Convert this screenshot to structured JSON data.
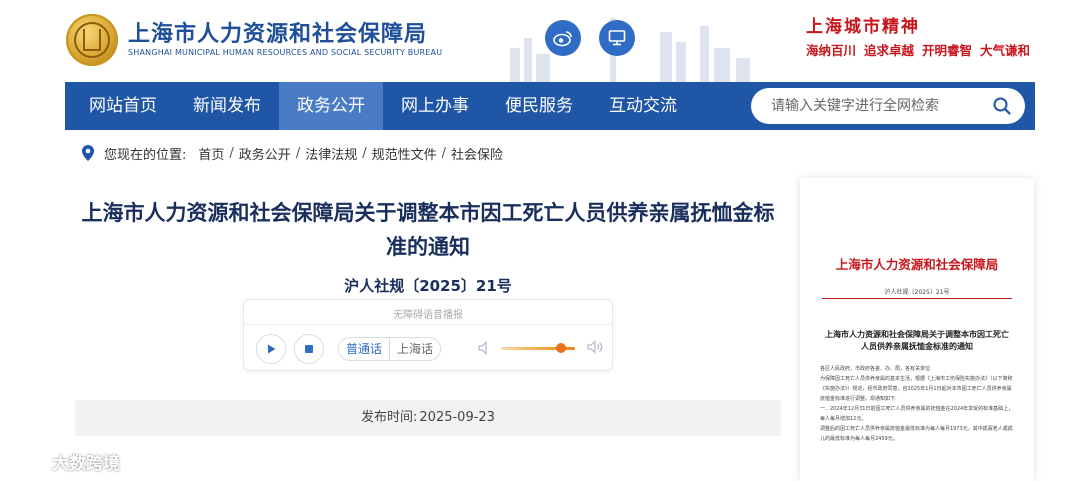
{
  "header": {
    "site_title": "上海市人力资源和社会保障局",
    "site_subtitle": "SHANGHAI MUNICIPAL HUMAN RESOURCES AND SOCIAL SECURITY BUREAU",
    "spirit_title": "上海城市精神",
    "spirit_words": [
      "海纳百川",
      "追求卓越",
      "开明睿智",
      "大气谦和"
    ],
    "weibo_icon": "weibo-icon",
    "monitor_icon": "monitor-icon"
  },
  "nav": {
    "items": [
      "网站首页",
      "新闻发布",
      "政务公开",
      "网上办事",
      "便民服务",
      "互动交流"
    ],
    "active_index": 2,
    "search_placeholder": "请输入关键字进行全网检索"
  },
  "breadcrumb": {
    "lead": "您现在的位置:",
    "items": [
      "首页",
      "政务公开",
      "法律法规",
      "规范性文件",
      "社会保险"
    ]
  },
  "article": {
    "title": "上海市人力资源和社会保障局关于调整本市因工死亡人员供养亲属抚恤金标准的通知",
    "doc_number": "沪人社规〔2025〕21号",
    "publish_label": "发布时间:",
    "publish_date": "2025-09-23"
  },
  "player": {
    "label": "无障碍语音播报",
    "languages": [
      "普通话",
      "上海话"
    ],
    "active_language": "普通话",
    "volume": 0.82
  },
  "doc_preview": {
    "org": "上海市人力资源和社会保障局",
    "doc_number": "沪人社规〔2025〕21号",
    "title": "上海市人力资源和社会保障局关于调整本市因工死亡人员供养亲属抚恤金标准的通知",
    "body": [
      "各区人民政府，市政府各委、办、局，各有关单位:",
      "为保障因工死亡人员供养亲属的基本生活，根据《上海市工伤保险实施办法》（以下简称《实施办法》）规定，经市政府同意，自2025年1月1日起对本市因工死亡人员供养亲属抚恤金标准进行调整。现通知如下:",
      "一、2024年12月31日前因工死亡人员供养亲属的抚恤金在2024年享受的标准基础上，每人每月增加12元。",
      "调整后的因工死亡人员供养亲属抚恤金最低标准为每人每月1973元，其中孤寡老人或孤儿的最低标准为每人每月2459元。"
    ]
  },
  "watermark": {
    "text": "大数跨境"
  },
  "colors": {
    "nav_bg": "#1f56a6",
    "nav_active": "#4a7cc5",
    "title_blue": "#1e4f98",
    "spirit_red": "#c8161d",
    "volume_orange": "#e8731a"
  }
}
